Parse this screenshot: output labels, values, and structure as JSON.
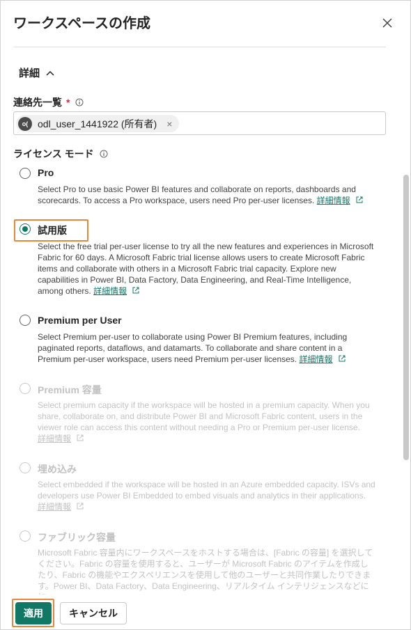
{
  "dialog": {
    "title": "ワークスペースの作成",
    "close_icon": "close-icon"
  },
  "details_section": {
    "label": "詳細",
    "expanded": true
  },
  "contacts": {
    "label": "連絡先一覧",
    "required_mark": "*",
    "chip": {
      "initials": "o(",
      "text": "odl_user_1441922 (所有者)",
      "remove": "×"
    }
  },
  "license_mode": {
    "label": "ライセンス モード",
    "selected": "trial",
    "learn_more": "詳細情報",
    "options": [
      {
        "id": "pro",
        "label": "Pro",
        "description": "Select Pro to use basic Power BI features and collaborate on reports, dashboards and scorecards. To access a Pro workspace, users need Pro per-user licenses.",
        "disabled": false
      },
      {
        "id": "trial",
        "label": "試用版",
        "description": "Select the free trial per-user license to try all the new features and experiences in Microsoft Fabric for 60 days. A Microsoft Fabric trial license allows users to create Microsoft Fabric items and collaborate with others in a Microsoft Fabric trial capacity. Explore new capabilities in Power BI, Data Factory, Data Engineering, and Real-Time Intelligence, among others.",
        "disabled": false
      },
      {
        "id": "ppu",
        "label": "Premium per User",
        "description": "Select Premium per-user to collaborate using Power BI Premium features, including paginated reports, dataflows, and datamarts. To collaborate and share content in a Premium per-user workspace, users need Premium per-user licenses.",
        "disabled": false
      },
      {
        "id": "premium",
        "label": "Premium 容量",
        "description": "Select premium capacity if the workspace will be hosted in a premium capacity. When you share, collaborate on, and distribute Power BI and Microsoft Fabric content, users in the viewer role can access this content without needing a Pro or Premium per-user license.",
        "disabled": true
      },
      {
        "id": "embedded",
        "label": "埋め込み",
        "description": "Select embedded if the workspace will be hosted in an Azure embedded capacity. ISVs and developers use Power BI Embedded to embed visuals and analytics in their applications.",
        "disabled": true
      },
      {
        "id": "fabric",
        "label": "ファブリック容量",
        "description": "Microsoft Fabric 容量内にワークスペースをホストする場合は、[Fabric の容量] を選択してください。Fabric の容量を使用すると、ユーザーが Microsoft Fabric のアイテムを作成したり、Fabric の機能やエクスペリエンスを使用して他のユーザーと共同作業したりできます。Power BI、Data Factory、Data Engineering、リアルタイム インテリジェンスなどに加",
        "disabled": true
      }
    ]
  },
  "footer": {
    "apply_label": "適用",
    "cancel_label": "キャンセル"
  },
  "colors": {
    "accent": "#117865",
    "highlight": "#e8873a",
    "link": "#117865"
  }
}
